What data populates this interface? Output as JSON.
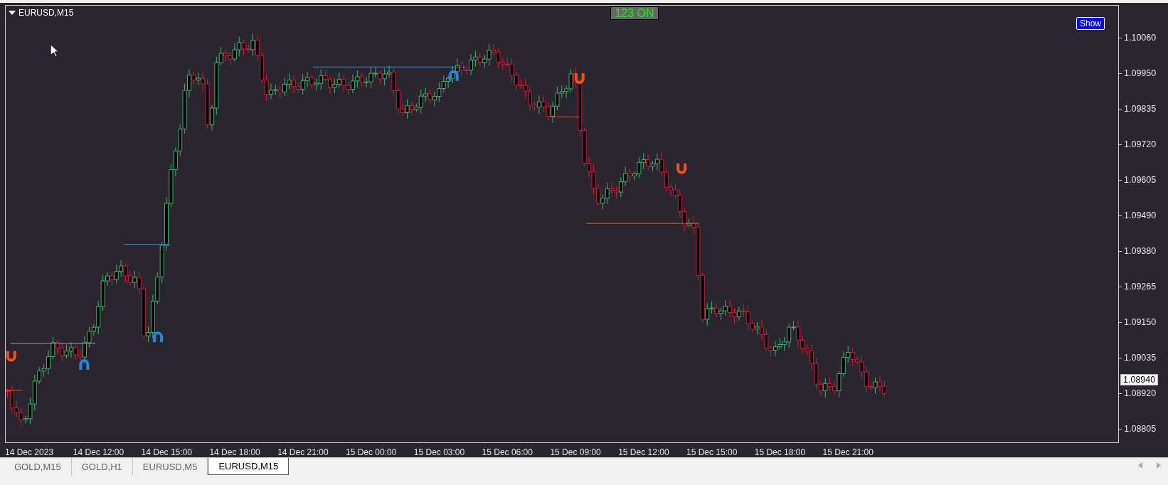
{
  "chart": {
    "title": "EURUSD,M15",
    "status_badge": "123 ON",
    "show_button": "Show",
    "price_axis": [
      "1.10060",
      "1.09950",
      "1.09835",
      "1.09720",
      "1.09605",
      "1.09490",
      "1.09380",
      "1.09265",
      "1.09150",
      "1.09035",
      "1.08920",
      "1.08805"
    ],
    "current_price": "1.08940",
    "time_axis": [
      "14 Dec 2023",
      "14 Dec 12:00",
      "14 Dec 15:00",
      "14 Dec 18:00",
      "14 Dec 21:00",
      "15 Dec 00:00",
      "15 Dec 03:00",
      "15 Dec 06:00",
      "15 Dec 09:00",
      "15 Dec 12:00",
      "15 Dec 15:00",
      "15 Dec 18:00",
      "15 Dec 21:00"
    ]
  },
  "tabs": [
    {
      "label": "GOLD,M15",
      "selected": false
    },
    {
      "label": "GOLD,H1",
      "selected": false
    },
    {
      "label": "EURUSD,M5",
      "selected": false
    },
    {
      "label": "EURUSD,M15",
      "selected": true
    }
  ]
}
